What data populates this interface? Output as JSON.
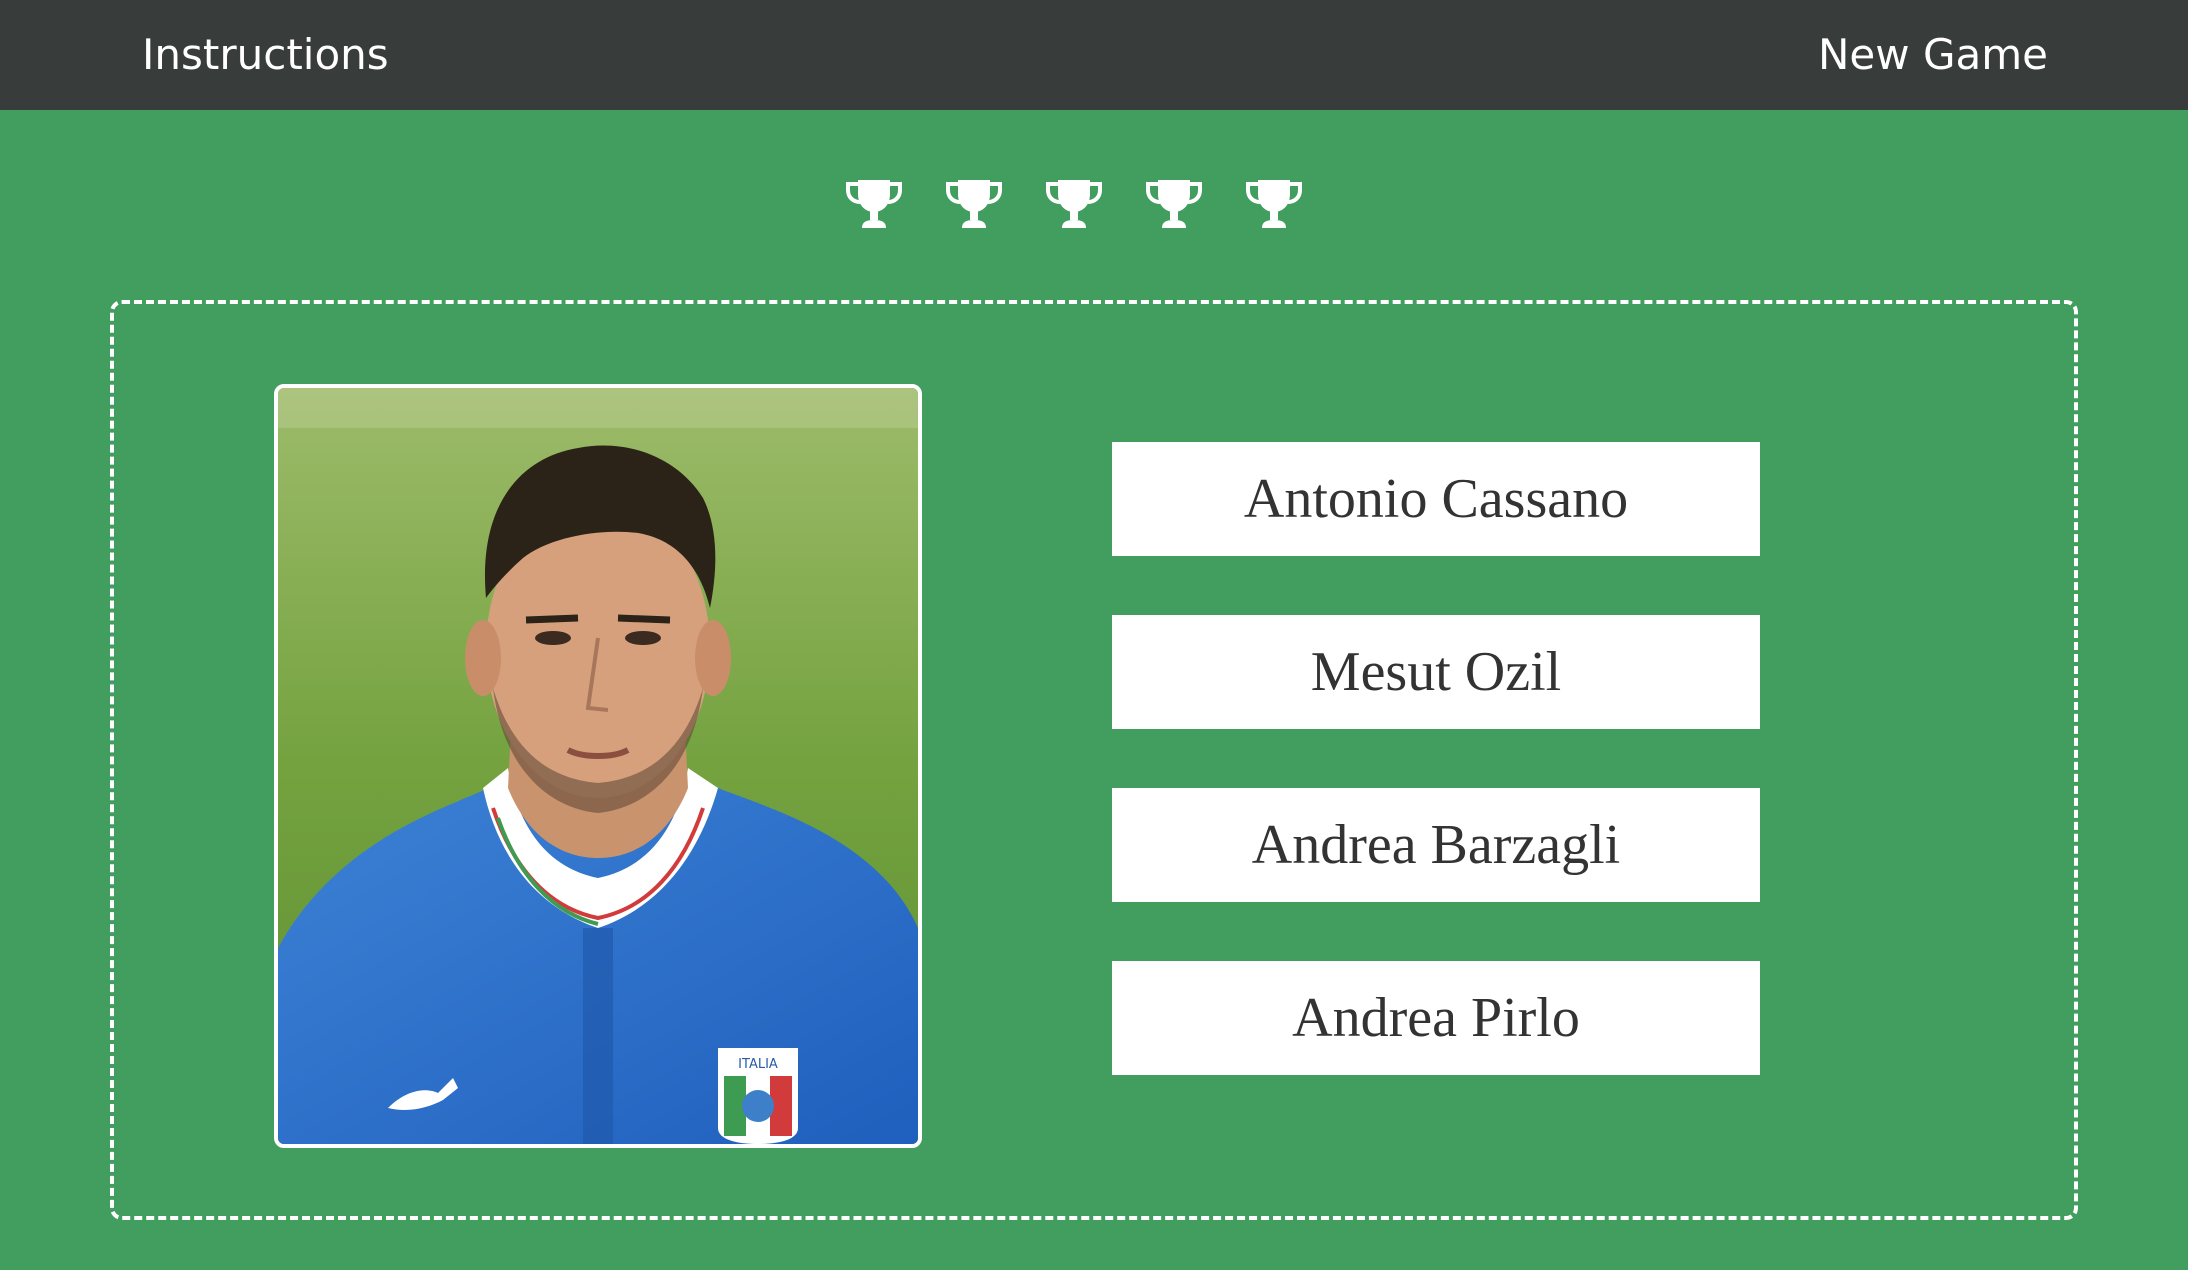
{
  "nav": {
    "instructions_label": "Instructions",
    "new_game_label": "New Game"
  },
  "trophies": {
    "count": 5,
    "icon": "trophy-icon",
    "color": "#ffffff"
  },
  "question": {
    "photo_alt": "Player photo",
    "badge_text": "ITALIA"
  },
  "answers": [
    {
      "label": "Antonio Cassano"
    },
    {
      "label": "Mesut Ozil"
    },
    {
      "label": "Andrea Barzagli"
    },
    {
      "label": "Andrea Pirlo"
    }
  ],
  "colors": {
    "background": "#429e5f",
    "topbar": "#383c3a",
    "answer_bg": "#ffffff",
    "answer_text": "#333333"
  }
}
